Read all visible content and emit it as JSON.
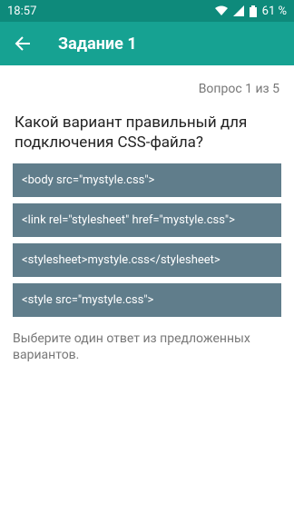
{
  "status": {
    "time": "18:57",
    "battery": "61 %"
  },
  "appbar": {
    "title": "Задание 1"
  },
  "quiz": {
    "progress": "Вопрос 1 из 5",
    "question": "Какой вариант правильный для подключения CSS-файла?",
    "options": [
      "<body src=\"mystyle.css\">",
      "<link rel=\"stylesheet\" href=\"mystyle.css\">",
      "<stylesheet>mystyle.css</stylesheet>",
      "<style src=\"mystyle.css\">"
    ],
    "hint": "Выберите один ответ из предложенных вариантов."
  },
  "colors": {
    "statusbar": "#0e8a7b",
    "appbar": "#16a292",
    "option": "#607d8b"
  }
}
